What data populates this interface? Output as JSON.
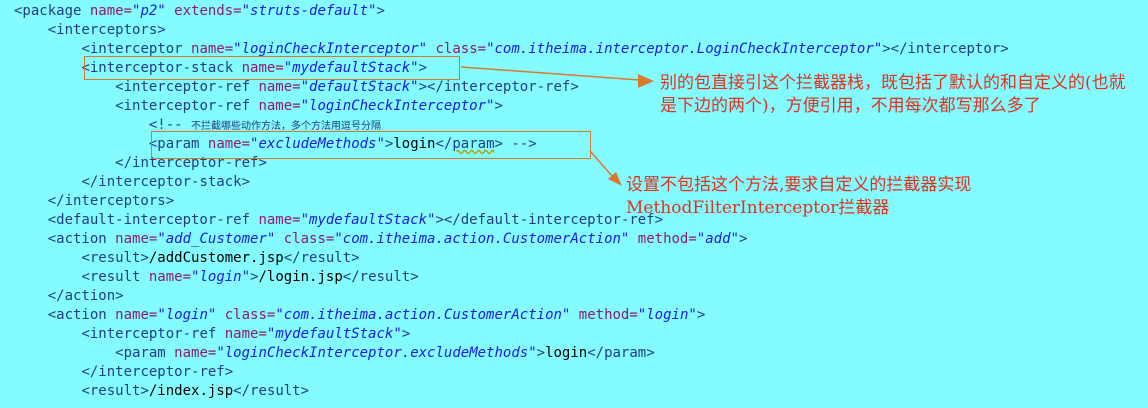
{
  "code_lines": [
    {
      "indent": 0,
      "tokens": [
        {
          "k": "t",
          "s": "<package "
        },
        {
          "k": "a",
          "s": "name="
        },
        {
          "k": "v",
          "s": "\"p2\""
        },
        {
          "k": "a",
          "s": " extends="
        },
        {
          "k": "v",
          "s": "\"struts-default\""
        },
        {
          "k": "t",
          "s": ">"
        }
      ]
    },
    {
      "indent": 4,
      "tokens": [
        {
          "k": "t",
          "s": "<interceptors>"
        }
      ]
    },
    {
      "indent": 8,
      "tokens": [
        {
          "k": "t",
          "s": "<interceptor "
        },
        {
          "k": "a",
          "s": "name="
        },
        {
          "k": "v",
          "s": "\"loginCheckInterceptor\""
        },
        {
          "k": "a",
          "s": " class="
        },
        {
          "k": "v",
          "s": "\"com.itheima.interceptor.LoginCheckInterceptor\""
        },
        {
          "k": "t",
          "s": "></interceptor>"
        }
      ]
    },
    {
      "indent": 8,
      "tokens": [
        {
          "k": "t",
          "s": "<interceptor-stack "
        },
        {
          "k": "a",
          "s": "name="
        },
        {
          "k": "v",
          "s": "\"mydefaultStack\""
        },
        {
          "k": "t",
          "s": ">"
        }
      ]
    },
    {
      "indent": 12,
      "tokens": [
        {
          "k": "t",
          "s": "<interceptor-ref "
        },
        {
          "k": "a",
          "s": "name="
        },
        {
          "k": "v",
          "s": "\"defaultStack\""
        },
        {
          "k": "t",
          "s": "></interceptor-ref>"
        }
      ]
    },
    {
      "indent": 12,
      "tokens": [
        {
          "k": "t",
          "s": "<interceptor-ref "
        },
        {
          "k": "a",
          "s": "name="
        },
        {
          "k": "v",
          "s": "\"loginCheckInterceptor\""
        },
        {
          "k": "t",
          "s": ">"
        }
      ]
    },
    {
      "indent": 16,
      "tokens": [
        {
          "k": "c",
          "s": "<!-- "
        },
        {
          "k": "cz",
          "s": "不拦截哪些动作方法，多个方法用逗号分隔"
        }
      ]
    },
    {
      "indent": 16,
      "tokens": [
        {
          "k": "t",
          "s": "<param "
        },
        {
          "k": "a",
          "s": "name="
        },
        {
          "k": "v",
          "s": "\"excludeMethods\""
        },
        {
          "k": "t",
          "s": ">"
        },
        {
          "k": "tx",
          "s": "login"
        },
        {
          "k": "t",
          "s": "</"
        },
        {
          "k": "tsq",
          "s": "param"
        },
        {
          "k": "t",
          "s": ">"
        },
        {
          "k": "c",
          "s": " -->"
        }
      ]
    },
    {
      "indent": 12,
      "tokens": [
        {
          "k": "t",
          "s": "</interceptor-ref>"
        }
      ]
    },
    {
      "indent": 8,
      "tokens": [
        {
          "k": "t",
          "s": "</interceptor-stack>"
        }
      ]
    },
    {
      "indent": 4,
      "tokens": [
        {
          "k": "t",
          "s": "</interceptors>"
        }
      ]
    },
    {
      "indent": 4,
      "tokens": [
        {
          "k": "t",
          "s": "<default-interceptor-ref "
        },
        {
          "k": "a",
          "s": "name="
        },
        {
          "k": "v",
          "s": "\"mydefaultStack\""
        },
        {
          "k": "t",
          "s": "></default-interceptor-ref>"
        }
      ]
    },
    {
      "indent": 4,
      "tokens": [
        {
          "k": "t",
          "s": "<action "
        },
        {
          "k": "a",
          "s": "name="
        },
        {
          "k": "v",
          "s": "\"add_Customer\""
        },
        {
          "k": "a",
          "s": " class="
        },
        {
          "k": "v",
          "s": "\"com.itheima.action.CustomerAction\""
        },
        {
          "k": "a",
          "s": " method="
        },
        {
          "k": "v",
          "s": "\"add\""
        },
        {
          "k": "t",
          "s": ">"
        }
      ]
    },
    {
      "indent": 8,
      "tokens": [
        {
          "k": "t",
          "s": "<result>"
        },
        {
          "k": "tx",
          "s": "/addCustomer.jsp"
        },
        {
          "k": "t",
          "s": "</result>"
        }
      ]
    },
    {
      "indent": 8,
      "tokens": [
        {
          "k": "t",
          "s": "<result "
        },
        {
          "k": "a",
          "s": "name="
        },
        {
          "k": "v",
          "s": "\"login\""
        },
        {
          "k": "t",
          "s": ">"
        },
        {
          "k": "tx",
          "s": "/login.jsp"
        },
        {
          "k": "t",
          "s": "</result>"
        }
      ]
    },
    {
      "indent": 4,
      "tokens": [
        {
          "k": "t",
          "s": "</action>"
        }
      ]
    },
    {
      "indent": 4,
      "tokens": [
        {
          "k": "t",
          "s": "<action "
        },
        {
          "k": "a",
          "s": "name="
        },
        {
          "k": "v",
          "s": "\"login\""
        },
        {
          "k": "a",
          "s": " class="
        },
        {
          "k": "v",
          "s": "\"com.itheima.action.CustomerAction\""
        },
        {
          "k": "a",
          "s": " method="
        },
        {
          "k": "v",
          "s": "\"login\""
        },
        {
          "k": "t",
          "s": ">"
        }
      ]
    },
    {
      "indent": 8,
      "tokens": [
        {
          "k": "t",
          "s": "<interceptor-ref "
        },
        {
          "k": "a",
          "s": "name="
        },
        {
          "k": "v",
          "s": "\"mydefaultStack\""
        },
        {
          "k": "t",
          "s": ">"
        }
      ]
    },
    {
      "indent": 12,
      "tokens": [
        {
          "k": "t",
          "s": "<param "
        },
        {
          "k": "a",
          "s": "name="
        },
        {
          "k": "v",
          "s": "\"loginCheckInterceptor.excludeMethods\""
        },
        {
          "k": "t",
          "s": ">"
        },
        {
          "k": "tx",
          "s": "login"
        },
        {
          "k": "t",
          "s": "</param>"
        }
      ]
    },
    {
      "indent": 8,
      "tokens": [
        {
          "k": "t",
          "s": "</interceptor-ref>"
        }
      ]
    },
    {
      "indent": 8,
      "tokens": [
        {
          "k": "t",
          "s": "<result>"
        },
        {
          "k": "tx",
          "s": "/index.jsp"
        },
        {
          "k": "t",
          "s": "</result>"
        }
      ]
    }
  ],
  "annotations": {
    "note1": "别的包直接引这个拦截器栈，既包括了默认的和自定义的(也就是下边的两个)，方便引用，不用每次都写那么多了",
    "note2": "设置不包括这个方法,要求自定义的拦截器实现MethodFilterInterceptor拦截器"
  },
  "colors": {
    "background": "#84fcff",
    "tag": "#1f3d85",
    "attribute": "#8a1d6c",
    "attribute_value": "#1a1ae6",
    "annotation_text": "#e0321f",
    "highlight_box": "#d9782f"
  }
}
